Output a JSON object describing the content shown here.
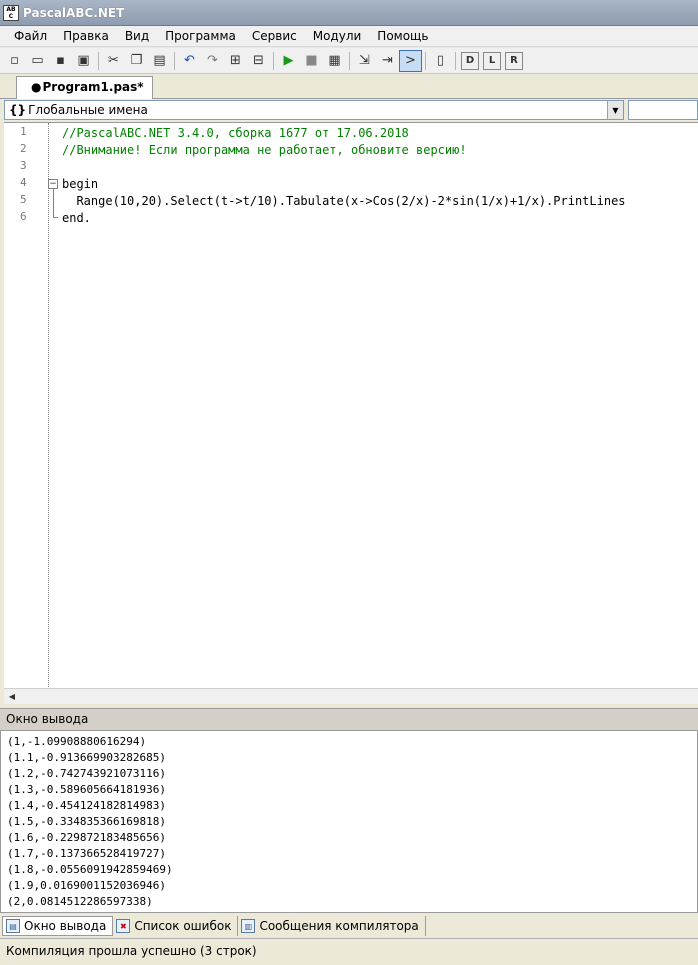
{
  "window": {
    "title": "PascalABC.NET"
  },
  "menu": [
    "Файл",
    "Правка",
    "Вид",
    "Программа",
    "Сервис",
    "Модули",
    "Помощь"
  ],
  "toolbar": {
    "groups": [
      [
        "new-file-icon",
        "open-file-icon",
        "save-icon",
        "save-all-icon"
      ],
      [
        "cut-icon",
        "copy-icon",
        "paste-icon"
      ],
      [
        "undo-icon",
        "redo-icon",
        "comment-icon",
        "uncomment-icon"
      ],
      [
        "run-icon",
        "stop-icon",
        "compile-icon"
      ],
      [
        "step-into-icon",
        "step-over-icon",
        "output-window-icon"
      ],
      [
        "form-icon"
      ],
      [
        "debug-d-icon",
        "debug-l-icon",
        "debug-r-icon"
      ]
    ],
    "active": "output-window-icon",
    "glyphs": {
      "new-file-icon": "▫",
      "open-file-icon": "▭",
      "save-icon": "▪",
      "save-all-icon": "▣",
      "cut-icon": "✂",
      "copy-icon": "❐",
      "paste-icon": "▤",
      "undo-icon": "↶",
      "redo-icon": "↷",
      "comment-icon": "⊞",
      "uncomment-icon": "⊟",
      "run-icon": "▶",
      "stop-icon": "■",
      "compile-icon": "▦",
      "step-into-icon": "⇲",
      "step-over-icon": "⇥",
      "output-window-icon": ">",
      "form-icon": "▯",
      "debug-d-icon": "D",
      "debug-l-icon": "L",
      "debug-r-icon": "R"
    },
    "colors": {
      "run-icon": "#1a9a1a",
      "stop-icon": "#888888",
      "undo-icon": "#1f4fb5",
      "redo-icon": "#7a7a7a"
    }
  },
  "editor_tab": {
    "label": "Program1.pas*",
    "dot": "●"
  },
  "scope_combo": {
    "icon": "{}",
    "value": "Глобальные имена"
  },
  "code": {
    "line_numbers": [
      "1",
      "2",
      "3",
      "4",
      "5",
      "6"
    ],
    "lines": [
      {
        "text": "//PascalABC.NET 3.4.0, сборка 1677 от 17.06.2018",
        "type": "comment"
      },
      {
        "text": "//Внимание! Если программа не работает, обновите версию!",
        "type": "comment"
      },
      {
        "text": "",
        "type": "plain"
      },
      {
        "text": "begin",
        "type": "kw"
      },
      {
        "text": "  Range(10,20).Select(t->t/10).Tabulate(x->Cos(2/x)-2*sin(1/x)+1/x).PrintLines",
        "type": "plain"
      },
      {
        "text": "end.",
        "type": "kw"
      }
    ]
  },
  "output": {
    "title": "Окно вывода",
    "lines": [
      "(1,-1.09908880616294)",
      "(1.1,-0.913669903282685)",
      "(1.2,-0.742743921073116)",
      "(1.3,-0.589605664181936)",
      "(1.4,-0.454124182814983)",
      "(1.5,-0.334835366169818)",
      "(1.6,-0.229872183485656)",
      "(1.7,-0.137366528419727)",
      "(1.8,-0.0556091942859469)",
      "(1.9,0.0169001152036946)",
      "(2,0.0814512286597338)"
    ]
  },
  "bottom_tabs": [
    {
      "label": "Окно вывода",
      "icon": "output-window-icon",
      "active": true
    },
    {
      "label": "Список ошибок",
      "icon": "error-list-icon",
      "active": false
    },
    {
      "label": "Сообщения компилятора",
      "icon": "compiler-messages-icon",
      "active": false
    }
  ],
  "status": {
    "text": "Компиляция прошла успешно (3 строк)"
  }
}
